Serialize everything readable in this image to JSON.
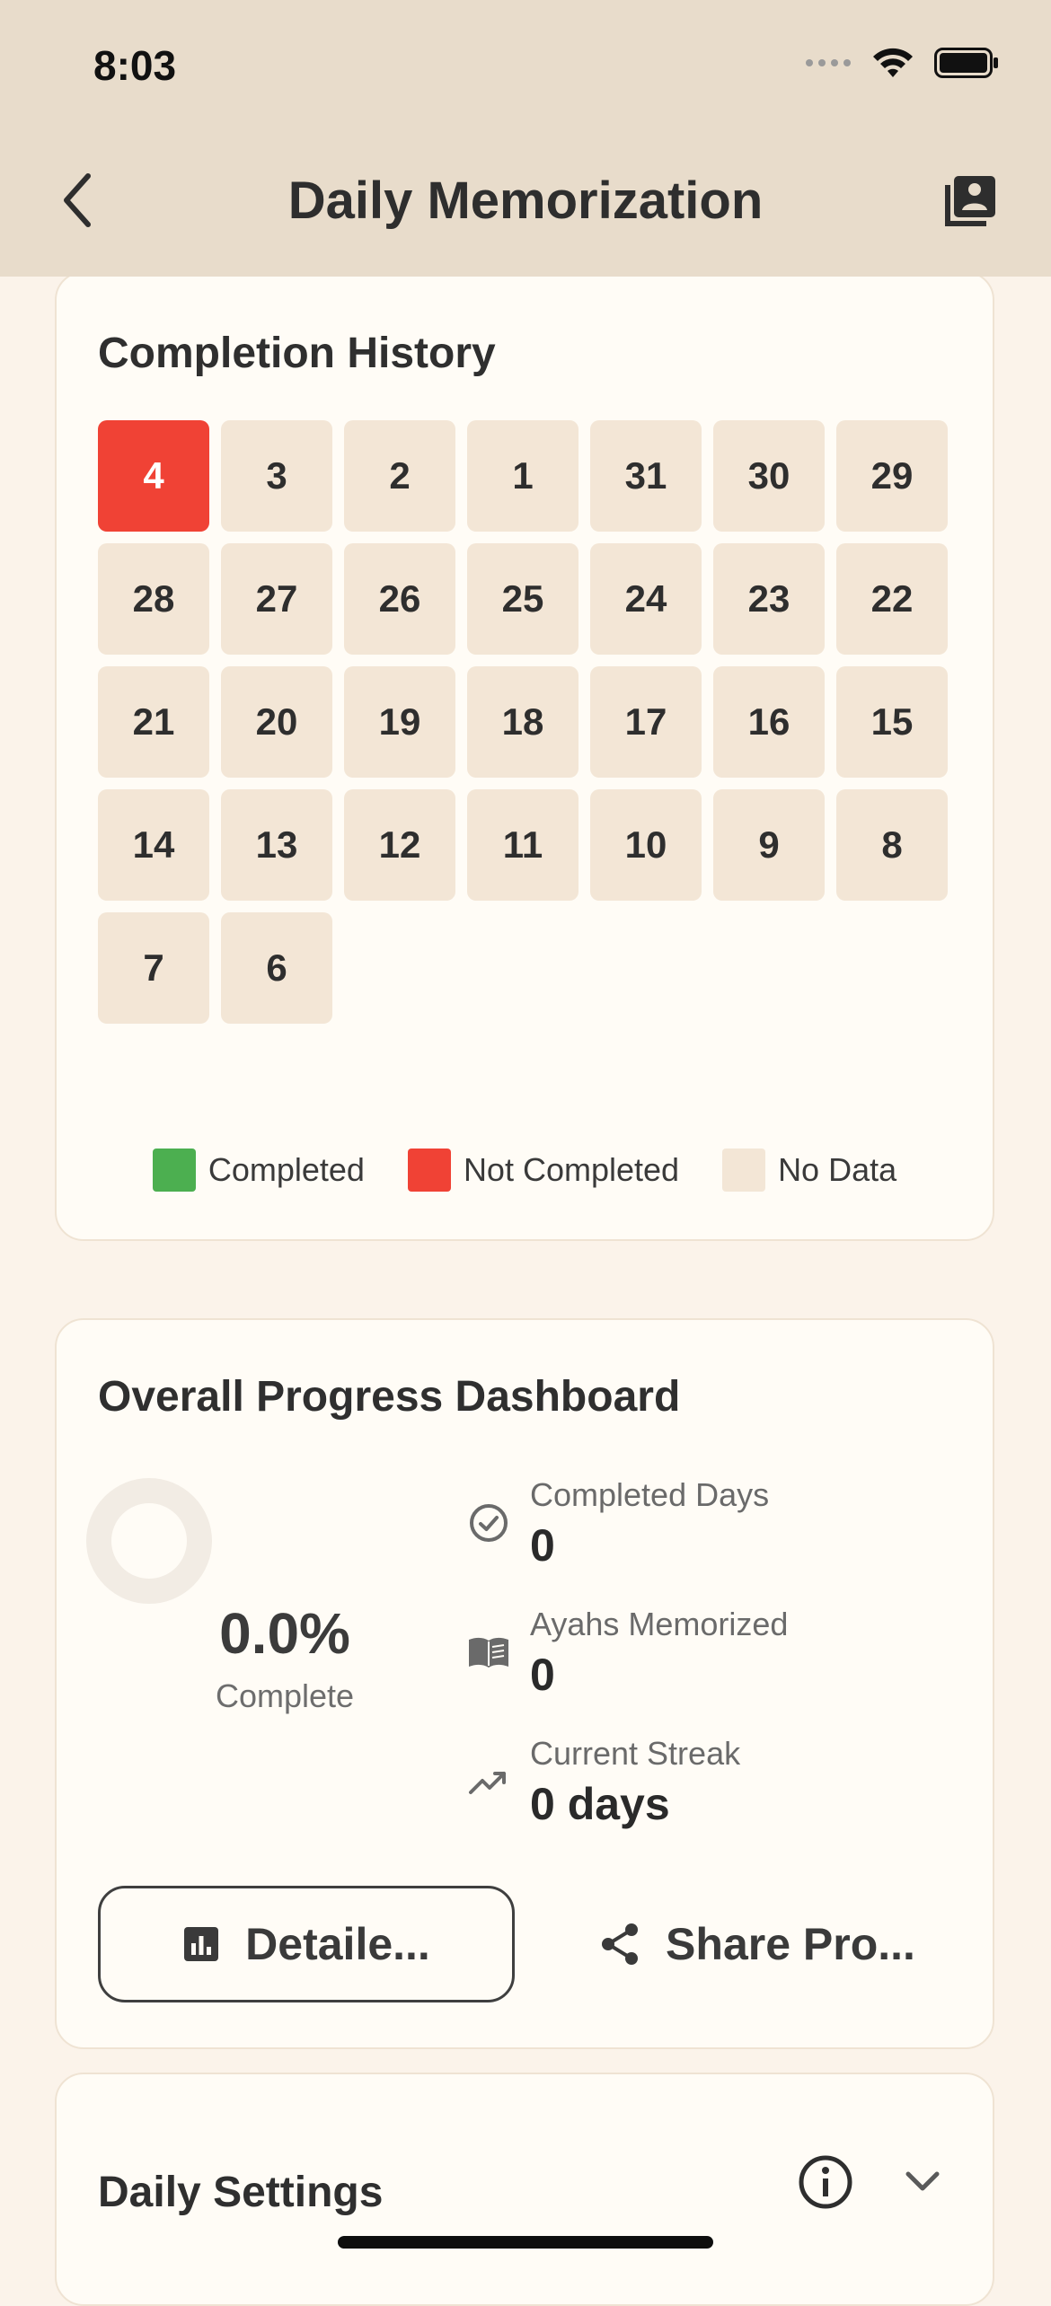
{
  "status_bar": {
    "time": "8:03"
  },
  "header": {
    "title": "Daily Memorization"
  },
  "completion_history": {
    "title": "Completion History",
    "days": [
      {
        "label": "4",
        "state": "not_completed"
      },
      {
        "label": "3",
        "state": "no_data"
      },
      {
        "label": "2",
        "state": "no_data"
      },
      {
        "label": "1",
        "state": "no_data"
      },
      {
        "label": "31",
        "state": "no_data"
      },
      {
        "label": "30",
        "state": "no_data"
      },
      {
        "label": "29",
        "state": "no_data"
      },
      {
        "label": "28",
        "state": "no_data"
      },
      {
        "label": "27",
        "state": "no_data"
      },
      {
        "label": "26",
        "state": "no_data"
      },
      {
        "label": "25",
        "state": "no_data"
      },
      {
        "label": "24",
        "state": "no_data"
      },
      {
        "label": "23",
        "state": "no_data"
      },
      {
        "label": "22",
        "state": "no_data"
      },
      {
        "label": "21",
        "state": "no_data"
      },
      {
        "label": "20",
        "state": "no_data"
      },
      {
        "label": "19",
        "state": "no_data"
      },
      {
        "label": "18",
        "state": "no_data"
      },
      {
        "label": "17",
        "state": "no_data"
      },
      {
        "label": "16",
        "state": "no_data"
      },
      {
        "label": "15",
        "state": "no_data"
      },
      {
        "label": "14",
        "state": "no_data"
      },
      {
        "label": "13",
        "state": "no_data"
      },
      {
        "label": "12",
        "state": "no_data"
      },
      {
        "label": "11",
        "state": "no_data"
      },
      {
        "label": "10",
        "state": "no_data"
      },
      {
        "label": "9",
        "state": "no_data"
      },
      {
        "label": "8",
        "state": "no_data"
      },
      {
        "label": "7",
        "state": "no_data"
      },
      {
        "label": "6",
        "state": "no_data"
      }
    ],
    "legend": {
      "completed": "Completed",
      "not_completed": "Not Completed",
      "no_data": "No Data"
    },
    "colors": {
      "completed": "#4CAF50",
      "not_completed": "#F04235",
      "no_data": "#F3E6D6"
    }
  },
  "dashboard": {
    "title": "Overall Progress Dashboard",
    "progress_fraction": 0.0,
    "percent_text": "0.0%",
    "percent_label": "Complete",
    "stats": {
      "completed_days": {
        "label": "Completed Days",
        "value": "0",
        "icon": "check-circle-icon"
      },
      "ayahs": {
        "label": "Ayahs Memorized",
        "value": "0",
        "icon": "book-icon"
      },
      "streak": {
        "label": "Current Streak",
        "value": "0 days",
        "icon": "trending-up-icon"
      }
    },
    "detailed_button": "Detaile...",
    "share_button": "Share Pro..."
  },
  "settings": {
    "title": "Daily Settings"
  }
}
